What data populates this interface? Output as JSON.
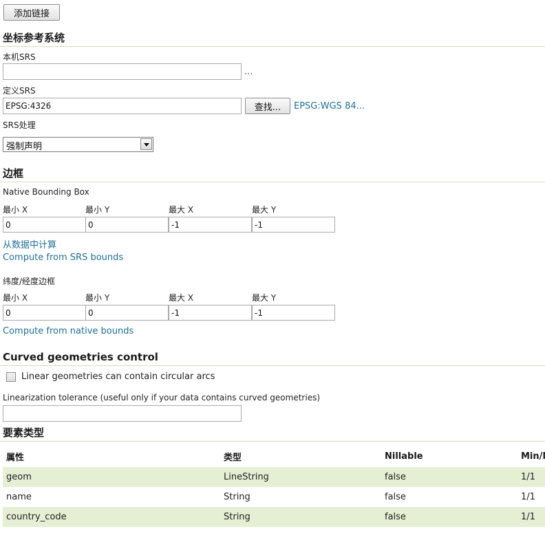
{
  "toolbar": {
    "add_link_label": "添加链接"
  },
  "crs": {
    "section_title": "坐标参考系统",
    "native_srs_label": "本机SRS",
    "native_srs_value": "",
    "native_srs_more": "...",
    "declared_srs_label": "定义SRS",
    "declared_srs_value": "EPSG:4326",
    "find_button": "查找...",
    "declared_srs_link": "EPSG:WGS 84...",
    "srs_handling_label": "SRS处理",
    "srs_handling_selected": "强制声明"
  },
  "bounds": {
    "section_title": "边框",
    "native": {
      "label": "Native Bounding Box",
      "headers": [
        "最小 X",
        "最小 Y",
        "最大 X",
        "最大 Y"
      ],
      "values": [
        "0",
        "0",
        "-1",
        "-1"
      ],
      "compute_from_data": "从数据中计算",
      "compute_from_srs": "Compute from SRS bounds"
    },
    "latlon": {
      "label": "纬度/经度边框",
      "headers": [
        "最小 X",
        "最小 Y",
        "最大 X",
        "最大 Y"
      ],
      "values": [
        "0",
        "0",
        "-1",
        "-1"
      ],
      "compute_from_native": "Compute from native bounds"
    }
  },
  "curved": {
    "section_title": "Curved geometries control",
    "circular_arcs_label": "Linear geometries can contain circular arcs",
    "circular_arcs_checked": false,
    "tolerance_label": "Linearization tolerance (useful only if your data contains curved geometries)",
    "tolerance_value": ""
  },
  "feature_type": {
    "section_title": "要素类型",
    "columns": [
      "属性",
      "类型",
      "Nillable",
      "Min/Max"
    ],
    "rows": [
      [
        "geom",
        "LineString",
        "false",
        "1/1"
      ],
      [
        "name",
        "String",
        "false",
        "1/1"
      ],
      [
        "country_code",
        "String",
        "false",
        "1/1"
      ]
    ]
  }
}
